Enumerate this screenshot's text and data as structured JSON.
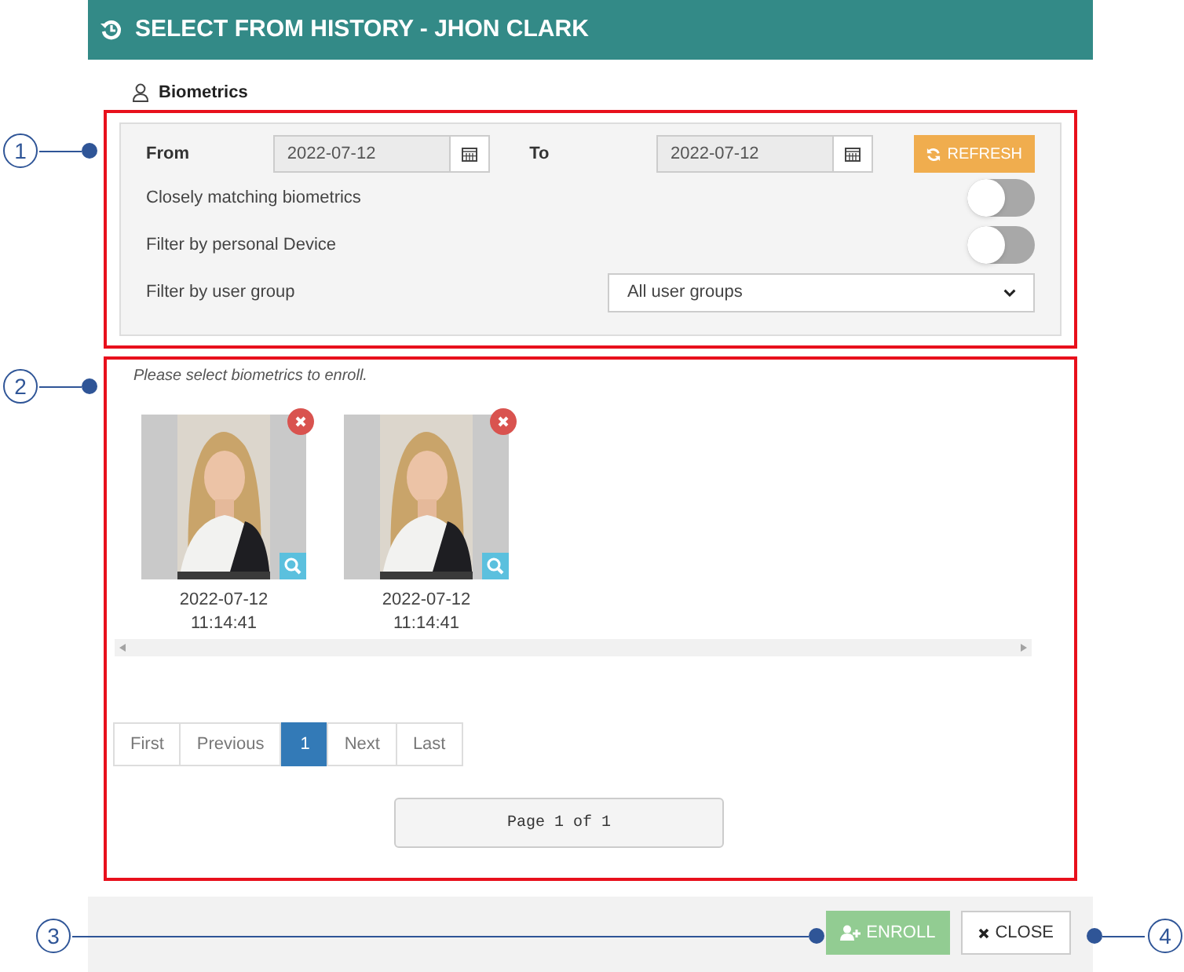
{
  "window": {
    "title": "SELECT FROM HISTORY - JHON CLARK"
  },
  "section": {
    "title": "Biometrics"
  },
  "filters": {
    "from_label": "From",
    "from_value": "2022-07-12",
    "to_label": "To",
    "to_value": "2022-07-12",
    "refresh_button": "REFRESH",
    "toggles": [
      {
        "label": "Closely matching biometrics",
        "on": false
      },
      {
        "label": "Filter by personal Device",
        "on": false
      }
    ],
    "group_label": "Filter by user group",
    "group_value": "All user groups"
  },
  "hint": "Please select biometrics to enroll.",
  "records": [
    {
      "kind": "picture",
      "date": "2022-07-12",
      "time": "11:14:41"
    },
    {
      "kind": "picture",
      "date": "2022-07-12",
      "time": "11:14:41"
    }
  ],
  "pagination": [
    {
      "label": "First",
      "selected": false
    },
    {
      "label": "Previous",
      "selected": false
    },
    {
      "label": "1",
      "selected": true
    },
    {
      "label": "Next",
      "selected": false
    },
    {
      "label": "Last",
      "selected": false
    }
  ],
  "page_info": "Page 1 of 1",
  "buttons": [
    {
      "kind": "enroll",
      "label": "ENROLL",
      "disabled": true
    },
    {
      "kind": "close",
      "label": "CLOSE",
      "disabled": false
    }
  ],
  "callouts": [
    "1",
    "2",
    "3",
    "4"
  ]
}
